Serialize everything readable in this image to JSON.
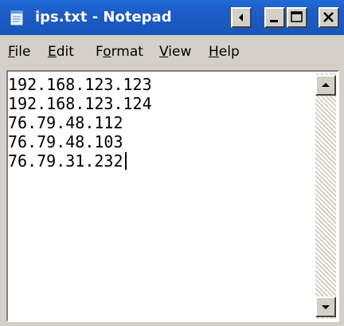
{
  "window": {
    "title": "ips.txt - Notepad",
    "title_bar_color": "#1e5bc5",
    "app_icon": "notepad-icon",
    "controls": [
      {
        "name": "scroll-left-icon",
        "glyph": "◂"
      },
      {
        "name": "minimize-icon",
        "glyph": "_"
      },
      {
        "name": "maximize-icon",
        "glyph": "☐"
      },
      {
        "name": "close-icon",
        "glyph": "✕"
      }
    ]
  },
  "menu": {
    "file": {
      "accel": "F",
      "rest": "ile"
    },
    "edit": {
      "accel": "E",
      "rest": "dit"
    },
    "format": {
      "pre": "F",
      "accel": "o",
      "rest": "rmat"
    },
    "view": {
      "accel": "V",
      "rest": "iew"
    },
    "help": {
      "accel": "H",
      "rest": "elp"
    }
  },
  "document": {
    "lines": [
      "192.168.123.123",
      "192.168.123.124",
      "76.79.48.112",
      "76.79.48.103",
      "76.79.31.232"
    ]
  },
  "scrollbar": {
    "up_icon": "scroll-up-arrow-icon",
    "down_icon": "scroll-down-arrow-icon"
  }
}
